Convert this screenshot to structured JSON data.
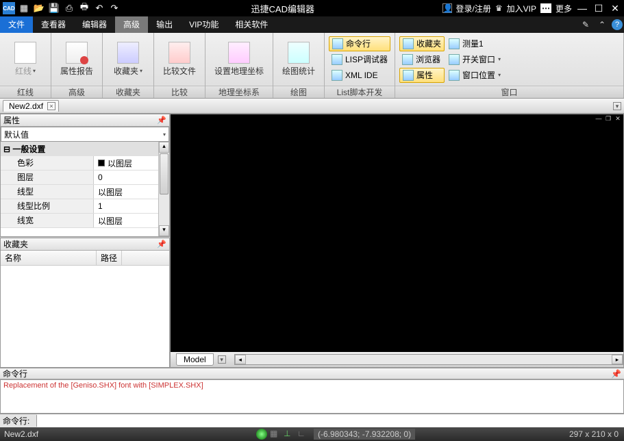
{
  "titlebar": {
    "title": "迅捷CAD编辑器",
    "login": "登录/注册",
    "vip": "加入VIP",
    "more": "更多"
  },
  "menu": {
    "file": "文件",
    "viewer": "查看器",
    "editor": "编辑器",
    "advanced": "高级",
    "output": "输出",
    "vipfunc": "VIP功能",
    "related": "相关软件"
  },
  "ribbon": {
    "g1": {
      "btn": "红线",
      "label": "红线"
    },
    "g2": {
      "btn": "属性报告",
      "label": "高级"
    },
    "g3": {
      "btn": "收藏夹",
      "label": "收藏夹"
    },
    "g4": {
      "btn": "比较文件",
      "label": "比较"
    },
    "g5": {
      "btn": "设置地理坐标",
      "label": "地理坐标系"
    },
    "g6": {
      "btn": "绘图统计",
      "label": "绘图"
    },
    "g7": {
      "b1": "命令行",
      "b2": "LISP调试器",
      "b3": "XML IDE",
      "label": "List脚本开发"
    },
    "g8": {
      "b1": "收藏夹",
      "b2": "浏览器",
      "b3": "属性",
      "b4": "测量1",
      "b5": "开关窗口",
      "b6": "窗口位置",
      "label": "窗口"
    }
  },
  "doctab": {
    "name": "New2.dxf"
  },
  "props": {
    "title": "属性",
    "default": "默认值",
    "section": "一般设置",
    "r1k": "色彩",
    "r1v": "以图层",
    "r2k": "图层",
    "r2v": "0",
    "r3k": "线型",
    "r3v": "以图层",
    "r4k": "线型比例",
    "r4v": "1",
    "r5k": "线宽",
    "r5v": "以图层"
  },
  "fav": {
    "title": "收藏夹",
    "col1": "名称",
    "col2": "路径"
  },
  "canvas": {
    "model": "Model"
  },
  "cmd": {
    "title": "命令行",
    "output": "Replacement of the [Geniso.SHX] font with [SIMPLEX.SHX]",
    "prompt": "命令行:"
  },
  "status": {
    "file": "New2.dxf",
    "coords": "(-6.980343; -7.932208; 0)",
    "dims": "297 x 210 x 0"
  }
}
